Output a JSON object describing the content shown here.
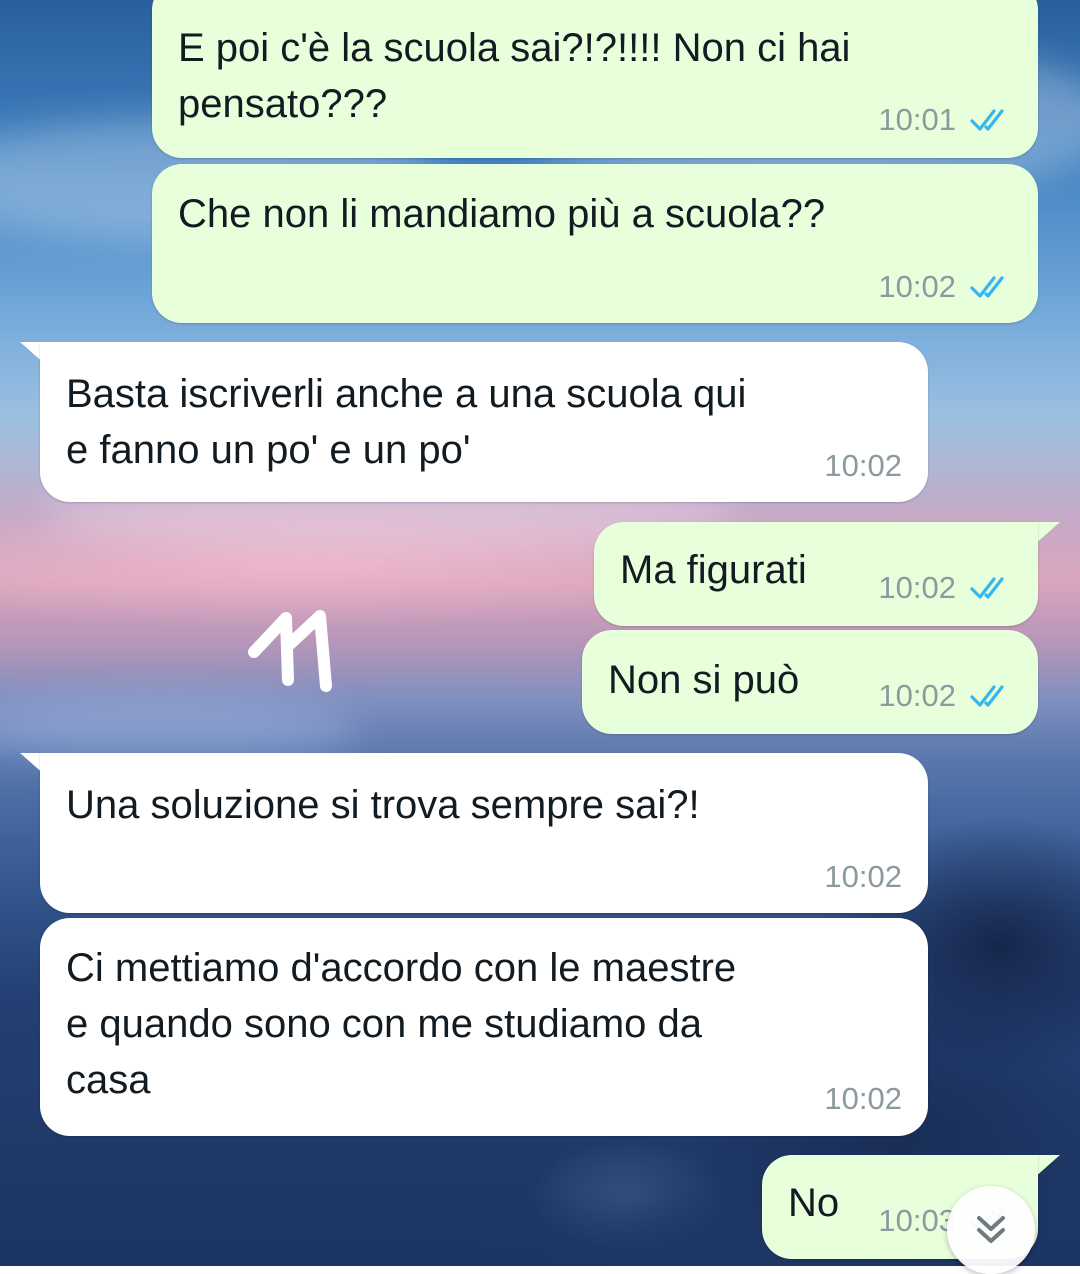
{
  "messages": [
    {
      "text": "E poi c'è la scuola sai?!?!!!! Non ci hai\npensato???",
      "time": "10:01",
      "read": true
    },
    {
      "text": "Che non li mandiamo più a scuola??",
      "time": "10:02",
      "read": true
    },
    {
      "text": "Basta iscriverli anche a una scuola qui\ne fanno un po' e un po'",
      "time": "10:02"
    },
    {
      "text": "Ma figurati",
      "time": "10:02",
      "read": true
    },
    {
      "text": "Non si può",
      "time": "10:02",
      "read": true
    },
    {
      "text": "Una soluzione si trova sempre sai?!",
      "time": "10:02"
    },
    {
      "text": "Ci mettiamo d'accordo con le maestre\ne quando sono con me studiamo da\ncasa",
      "time": "10:02"
    },
    {
      "text": "No",
      "time": "10:03",
      "read": true
    }
  ],
  "colors": {
    "outgoing_bubble": "#e7ffdb",
    "incoming_bubble": "#ffffff",
    "read_ticks": "#34b7f1",
    "timestamp": "#8c9a9f"
  },
  "icons": {
    "read_receipt": "double-check-icon",
    "scroll_down": "chevron-double-down-icon",
    "drawing": "handwritten-11-drawing"
  }
}
